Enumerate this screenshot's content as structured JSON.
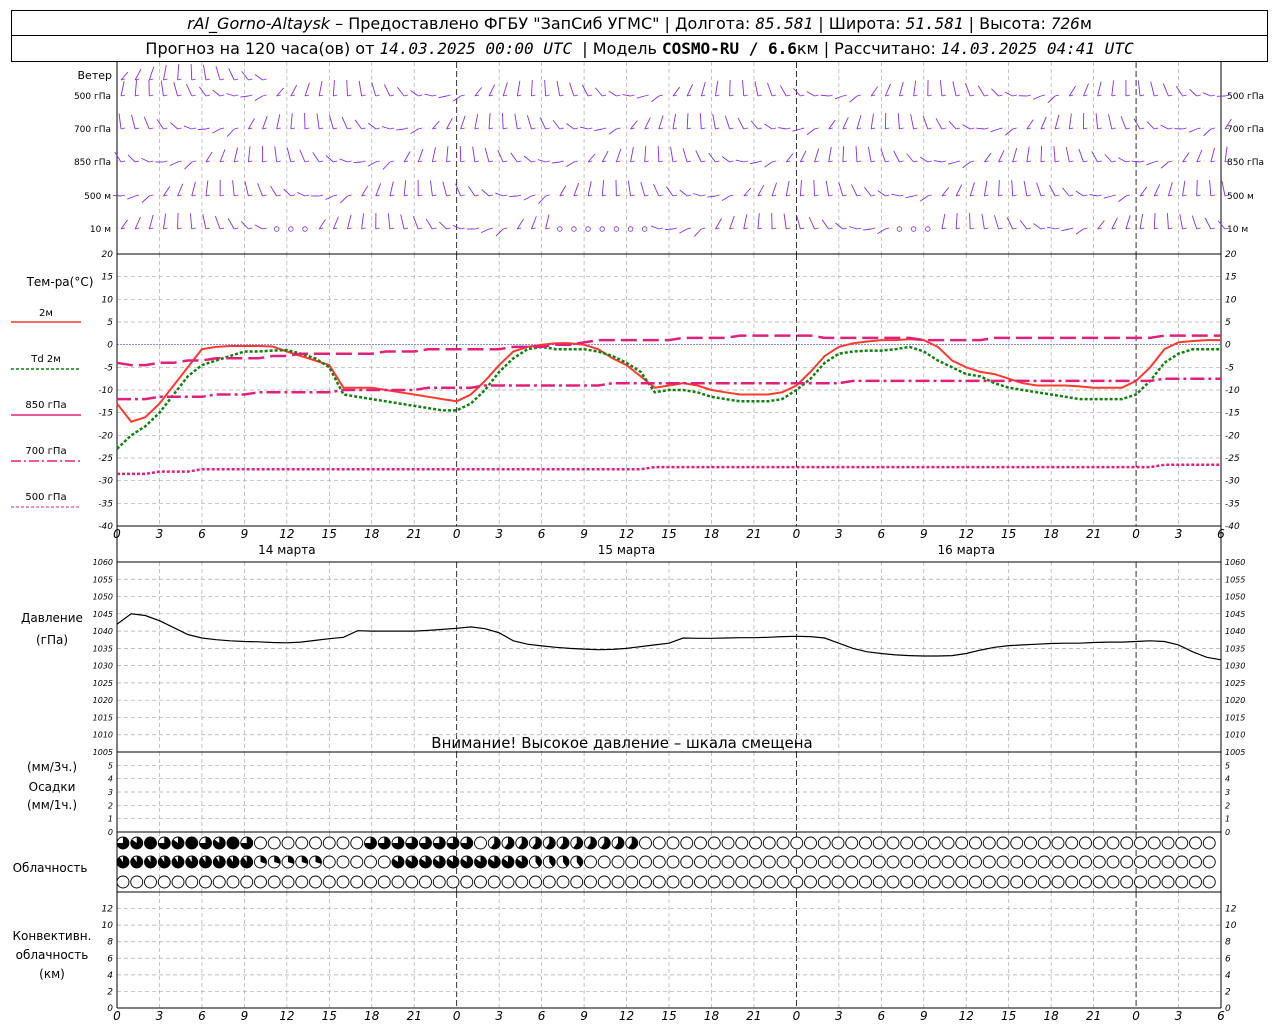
{
  "header": {
    "line1": {
      "station": "rAl_Gorno-Altaysk",
      "provider": " – Предоставлено ФГБУ \"ЗапСиб УГМС\" | Долгота: ",
      "lon": "85.581",
      "lat_label": " | Широта: ",
      "lat": "51.581",
      "alt_label": " | Высота: ",
      "alt": "726",
      "alt_unit": "м"
    },
    "line2": {
      "fc_label": "Прогноз на 120 часа(ов) от ",
      "fc_time": "14.03.2025 00:00 UTC",
      "model_label": "  | Модель ",
      "model": "COSMO-RU / 6.6",
      "model_unit": "км",
      "calc_label": " | Рассчитано: ",
      "calc_time": "14.03.2025 04:41 UTC"
    }
  },
  "wind_panel": {
    "title": "Ветер",
    "levels": [
      "500 гПа",
      "700 гПа",
      "850 гПа",
      "500 м",
      "10  м"
    ],
    "colors": {
      "barb": "#8a2be2"
    }
  },
  "temp_panel": {
    "title": "Тем-ра(°C)",
    "legend": [
      "2м",
      "Td  2м",
      "850 гПа",
      "700 гПа",
      "500 гПа"
    ],
    "yticks": [
      "20",
      "15",
      "10",
      "5",
      "0",
      "-5",
      "-10",
      "-15",
      "-20",
      "-25",
      "-30",
      "-35",
      "-40"
    ],
    "colors": {
      "t2m": "#ff3b30",
      "td2m": "#108010",
      "p850": "#e0207a",
      "p700": "#e0207a",
      "p500": "#e0207a",
      "zero": "#4040ff"
    }
  },
  "time_axis": {
    "ticks": [
      "0",
      "3",
      "6",
      "9",
      "12",
      "15",
      "18",
      "21",
      "0",
      "3",
      "6",
      "9",
      "12",
      "15",
      "18",
      "21",
      "0",
      "3",
      "6",
      "9",
      "12",
      "15",
      "18",
      "21",
      "0",
      "3",
      "6"
    ],
    "days": [
      "14 марта",
      "15 марта",
      "16 марта"
    ]
  },
  "pressure_panel": {
    "title": "Давление",
    "unit": "(гПа)",
    "yticks": [
      "1060",
      "1055",
      "1050",
      "1045",
      "1040",
      "1035",
      "1030",
      "1025",
      "1020",
      "1015",
      "1010",
      "1005"
    ],
    "warning": "Внимание! Высокое давление – шкала смещена"
  },
  "precip_panel": {
    "label_top": "(мм/3ч.)",
    "title": "Осадки",
    "label_bottom": "(мм/1ч.)",
    "yticks": [
      "5",
      "4",
      "3",
      "2",
      "1",
      "0"
    ]
  },
  "cloud_panel": {
    "title": "Облачность"
  },
  "conv_panel": {
    "title_1": "Конвективн.",
    "title_2": "облачность",
    "unit": "(км)",
    "yticks": [
      "12",
      "10",
      "8",
      "6",
      "4",
      "2",
      "0"
    ]
  },
  "chart_data": {
    "type": "line",
    "x_hours": [
      0,
      1,
      2,
      3,
      4,
      5,
      6,
      7,
      8,
      9,
      10,
      11,
      12,
      13,
      14,
      15,
      16,
      17,
      18,
      19,
      20,
      21,
      22,
      23,
      24,
      25,
      26,
      27,
      28,
      29,
      30,
      31,
      32,
      33,
      34,
      35,
      36,
      37,
      38,
      39,
      40,
      41,
      42,
      43,
      44,
      45,
      46,
      47,
      48,
      49,
      50,
      51,
      52,
      53,
      54,
      55,
      56,
      57,
      58,
      59,
      60,
      61,
      62,
      63,
      64,
      65,
      66,
      67,
      68,
      69,
      70,
      71,
      72,
      73,
      74,
      75,
      76,
      77,
      78
    ],
    "series": [
      {
        "name": "2м",
        "values": [
          -13,
          -17,
          -16,
          -13,
          -9,
          -5,
          -1,
          -0.5,
          -0.3,
          -0.3,
          -0.3,
          -0.4,
          -1.5,
          -2.5,
          -3.5,
          -4.5,
          -9.5,
          -9.5,
          -9.5,
          -10,
          -10.5,
          -11,
          -11.5,
          -12,
          -12.5,
          -11,
          -8,
          -4.5,
          -1.5,
          -0.5,
          0,
          0.3,
          0.3,
          0,
          -1,
          -3,
          -4.5,
          -7,
          -9.5,
          -9,
          -8.5,
          -9,
          -10,
          -10.5,
          -11,
          -11,
          -11,
          -10.5,
          -9,
          -6,
          -2.5,
          -0.5,
          0.3,
          0.7,
          1,
          1,
          1.2,
          1,
          -0.5,
          -3.5,
          -5,
          -6,
          -6.5,
          -7.5,
          -8.5,
          -9,
          -9,
          -9,
          -9.2,
          -9.5,
          -9.5,
          -9.5,
          -8,
          -5,
          -1,
          0.5,
          0.8,
          1,
          1
        ]
      },
      {
        "name": "Td 2м",
        "values": [
          -23,
          -20,
          -18,
          -15,
          -11,
          -7,
          -4.5,
          -3.5,
          -2.5,
          -1.5,
          -1.5,
          -1.3,
          -1.2,
          -2,
          -3,
          -5,
          -11,
          -11.5,
          -12,
          -12.5,
          -13,
          -13.5,
          -14,
          -14.5,
          -14.5,
          -13,
          -10,
          -6,
          -3,
          -1,
          -0.5,
          -1,
          -1,
          -1,
          -1.5,
          -2.5,
          -4,
          -6,
          -10.5,
          -10,
          -10,
          -10.5,
          -11.5,
          -12,
          -12.5,
          -12.5,
          -12.5,
          -12,
          -10,
          -7.5,
          -4,
          -2,
          -1.5,
          -1.3,
          -1.3,
          -1,
          -0.5,
          -1.5,
          -3.5,
          -5,
          -6.5,
          -7,
          -8.5,
          -9.5,
          -10,
          -10.5,
          -11,
          -11.5,
          -12,
          -12,
          -12,
          -12,
          -11,
          -8,
          -4,
          -2,
          -1,
          -1,
          -1
        ]
      },
      {
        "name": "850 гПа",
        "values": [
          -4,
          -4.5,
          -4.5,
          -4,
          -4,
          -3.5,
          -3.5,
          -3,
          -3,
          -3,
          -3,
          -2.5,
          -2.5,
          -2,
          -2,
          -2,
          -2,
          -2,
          -2,
          -1.5,
          -1.5,
          -1.5,
          -1,
          -1,
          -1,
          -1,
          -1,
          -1,
          -0.5,
          -0.5,
          -0.5,
          0,
          0,
          0.5,
          1,
          1,
          1,
          1,
          1,
          1,
          1.5,
          1.5,
          1.5,
          1.5,
          2,
          2,
          2,
          2,
          2,
          2,
          1.5,
          1.5,
          1.5,
          1.5,
          1.5,
          1.5,
          1.5,
          1,
          1,
          1,
          1,
          1,
          1.5,
          1.5,
          1.5,
          1.5,
          1.5,
          1.5,
          1.5,
          1.5,
          1.5,
          1.5,
          1.5,
          1.5,
          2,
          2,
          2,
          2,
          2
        ]
      },
      {
        "name": "700 гПа",
        "values": [
          -12,
          -12,
          -12,
          -11.5,
          -11.5,
          -11.5,
          -11.5,
          -11,
          -11,
          -11,
          -10.5,
          -10.5,
          -10.5,
          -10.5,
          -10.5,
          -10.5,
          -10,
          -10,
          -10,
          -10,
          -10,
          -10,
          -9.5,
          -9.5,
          -9.5,
          -9.5,
          -9,
          -9,
          -9,
          -9,
          -9,
          -9,
          -9,
          -9,
          -9,
          -8.5,
          -8.5,
          -8.5,
          -8.5,
          -8.5,
          -8.5,
          -8.5,
          -8.5,
          -8.5,
          -8.5,
          -8.5,
          -8.5,
          -8.5,
          -8.5,
          -8.5,
          -8.5,
          -8.5,
          -8,
          -8,
          -8,
          -8,
          -8,
          -8,
          -8,
          -8,
          -8,
          -8,
          -8,
          -8,
          -8,
          -8,
          -8,
          -8,
          -8,
          -8,
          -8,
          -8,
          -8,
          -8,
          -7.5,
          -7.5,
          -7.5,
          -7.5,
          -7.5
        ]
      },
      {
        "name": "500 гПа",
        "values": [
          -28.5,
          -28.5,
          -28.5,
          -28,
          -28,
          -28,
          -27.5,
          -27.5,
          -27.5,
          -27.5,
          -27.5,
          -27.5,
          -27.5,
          -27.5,
          -27.5,
          -27.5,
          -27.5,
          -27.5,
          -27.5,
          -27.5,
          -27.5,
          -27.5,
          -27.5,
          -27.5,
          -27.5,
          -27.5,
          -27.5,
          -27.5,
          -27.5,
          -27.5,
          -27.5,
          -27.5,
          -27.5,
          -27.5,
          -27.5,
          -27.5,
          -27.5,
          -27.5,
          -27,
          -27,
          -27,
          -27,
          -27,
          -27,
          -27,
          -27,
          -27,
          -27,
          -27,
          -27,
          -27,
          -27,
          -27,
          -27,
          -27,
          -27,
          -27,
          -27,
          -27,
          -27,
          -27,
          -27,
          -27,
          -27,
          -27,
          -27,
          -27,
          -27,
          -27,
          -27,
          -27,
          -27,
          -27,
          -27,
          -26.5,
          -26.5,
          -26.5,
          -26.5,
          -26.5
        ]
      },
      {
        "name": "Давление",
        "values": [
          1042,
          1045,
          1044.5,
          1043,
          1041,
          1039,
          1038,
          1037.5,
          1037.2,
          1037,
          1036.9,
          1036.7,
          1036.6,
          1036.8,
          1037.3,
          1037.8,
          1038.2,
          1040.1,
          1040,
          1040,
          1040,
          1040,
          1040.2,
          1040.5,
          1040.8,
          1041.2,
          1040.7,
          1039.5,
          1037.2,
          1036.2,
          1035.7,
          1035.3,
          1035,
          1034.8,
          1034.6,
          1034.7,
          1035,
          1035.5,
          1036,
          1036.5,
          1038,
          1037.9,
          1037.9,
          1038,
          1038.1,
          1038.1,
          1038.2,
          1038.4,
          1038.5,
          1038.4,
          1038,
          1036.5,
          1035,
          1034,
          1033.5,
          1033.1,
          1032.9,
          1032.8,
          1032.8,
          1032.9,
          1033.5,
          1034.5,
          1035.3,
          1035.8,
          1036,
          1036.2,
          1036.4,
          1036.5,
          1036.5,
          1036.7,
          1036.8,
          1036.8,
          1037,
          1037.2,
          1037,
          1036,
          1034,
          1032.4,
          1031.7
        ]
      }
    ],
    "ylim_temp": [
      -40,
      20
    ],
    "ylim_pressure": [
      1005,
      1060
    ],
    "xlim_hours": [
      0,
      78
    ],
    "grid": true
  }
}
